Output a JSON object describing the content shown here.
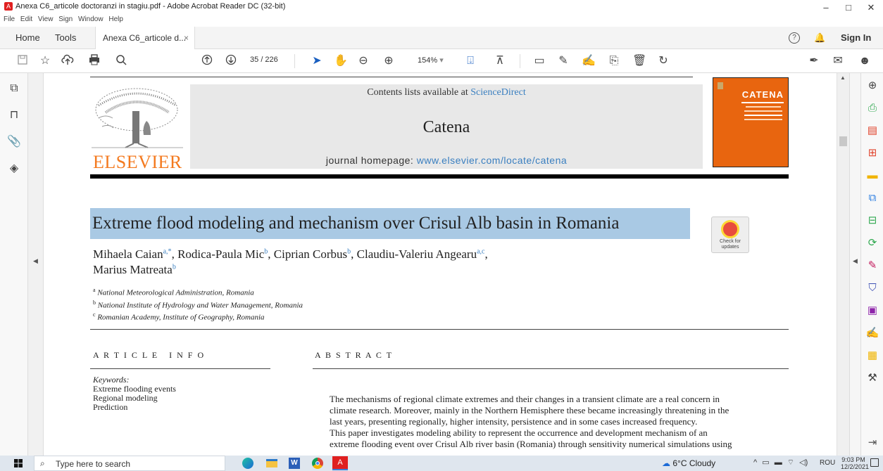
{
  "window": {
    "title": "Anexa C6_articole doctoranzi in stagiu.pdf - Adobe Acrobat Reader DC (32-bit)",
    "minimize": "–",
    "maximize": "□",
    "close": "✕"
  },
  "menu": [
    "File",
    "Edit",
    "View",
    "Sign",
    "Window",
    "Help"
  ],
  "tabs": {
    "home": "Home",
    "tools": "Tools",
    "doc": "Anexa C6_articole d...",
    "doc_close": "×",
    "help": "?",
    "sign_in": "Sign In"
  },
  "toolbar": {
    "page_current": "35",
    "page_total": "/ 226",
    "zoom": "154%"
  },
  "header": {
    "contents": "Contents lists available at ",
    "sciencedirect": "ScienceDirect",
    "journal": "Catena",
    "homepage_label": "journal homepage: ",
    "homepage_url": "www.elsevier.com/locate/catena",
    "publisher": "ELSEVIER",
    "cover_title": "CATENA"
  },
  "article": {
    "title": "Extreme flood modeling and mechanism over Crisul Alb basin in Romania",
    "check": "Check for updates",
    "authors": [
      {
        "name": "Mihaela Caian",
        "sup": "a,*",
        "sep": ", "
      },
      {
        "name": "Rodica-Paula Mic",
        "sup": "b",
        "sep": ", "
      },
      {
        "name": "Ciprian Corbus",
        "sup": "b",
        "sep": ", "
      },
      {
        "name": "Claudiu-Valeriu Angearu",
        "sup": "a,c",
        "sep": ","
      }
    ],
    "author_last": {
      "name": "Marius Matreata",
      "sup": "b"
    },
    "affiliations": [
      {
        "sup": "a",
        "text": "National Meteorological Administration, Romania"
      },
      {
        "sup": "b",
        "text": "National Institute of Hydrology and Water Management, Romania"
      },
      {
        "sup": "c",
        "text": "Romanian Academy, Institute of Geography, Romania"
      }
    ],
    "article_info_heading": "A R T I C L E   I N F O",
    "abstract_heading": "A B S T R A C T",
    "keywords_label": "Keywords:",
    "keywords": [
      "Extreme flooding events",
      "Regional modeling",
      "Prediction"
    ],
    "abstract_lines": [
      "The mechanisms of regional climate extremes and their changes in a transient climate are a real concern in",
      "climate research. Moreover, mainly in the Northern Hemisphere these became increasingly threatening in the",
      "last years, presenting regionally, higher intensity, persistence and in some cases increased frequency.",
      "This paper investigates modeling ability to represent the occurrence and development mechanism of an",
      "extreme flooding event over Crisul Alb river basin (Romania) through sensitivity numerical simulations using"
    ]
  },
  "taskbar": {
    "search": "Type here to search",
    "weather": "6°C  Cloudy",
    "lang": "ROU",
    "time": "9:03 PM",
    "date": "12/2/2021"
  }
}
